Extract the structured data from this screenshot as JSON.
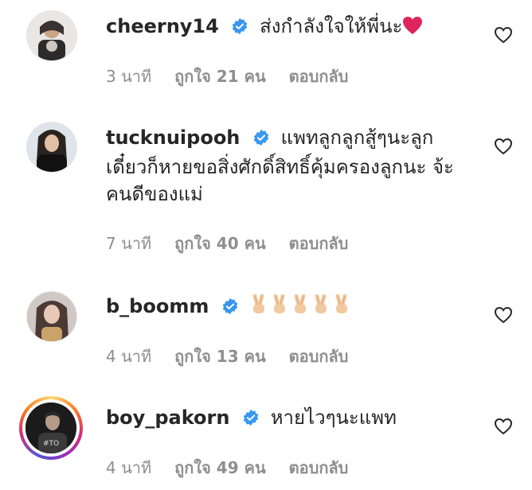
{
  "comments": [
    {
      "username": "cheerny14",
      "text": "ส่งกำลังใจให้พี่นะ",
      "time": "3 นาที",
      "likes": "ถูกใจ 21 คน",
      "reply": "ตอบกลับ"
    },
    {
      "username": "tucknuipooh",
      "text": "แพทลูกลูกสู้ๆนะลูก เดี๋ยวก็หายขอสิ่งศักดิ์สิทธิ์คุ้มครองลูกนะ จ้ะคนดีของแม่",
      "time": "7 นาที",
      "likes": "ถูกใจ 40 คน",
      "reply": "ตอบกลับ"
    },
    {
      "username": "b_boomm",
      "text": "",
      "time": "4 นาที",
      "likes": "ถูกใจ 13 คน",
      "reply": "ตอบกลับ"
    },
    {
      "username": "boy_pakorn",
      "text": "หายไวๆนะแพท",
      "time": "4 นาที",
      "likes": "ถูกใจ 49 คน",
      "reply": "ตอบกลับ"
    }
  ],
  "icons": {
    "verified": "verified-badge-icon",
    "like": "heart-outline-icon",
    "red_heart": "red-heart-emoji",
    "victory": "victory-hand-emoji"
  },
  "colors": {
    "verified": "#3897f0",
    "meta_text": "#8e8e8e",
    "red_heart": "#e0245e"
  }
}
